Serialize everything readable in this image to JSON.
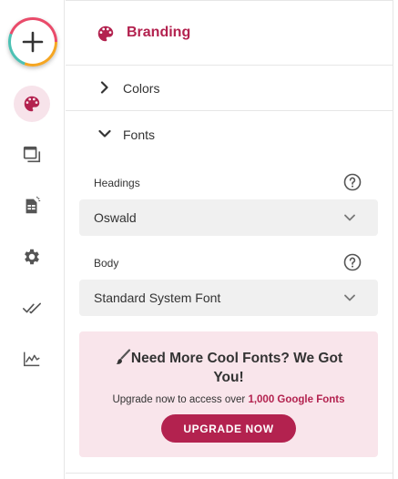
{
  "rail": {
    "add_button": "plus-icon",
    "items": [
      {
        "icon": "palette-icon",
        "active": true
      },
      {
        "icon": "window-stack-icon",
        "active": false
      },
      {
        "icon": "sheet-icon",
        "active": false
      },
      {
        "icon": "gear-icon",
        "active": false
      },
      {
        "icon": "double-check-icon",
        "active": false
      },
      {
        "icon": "chart-icon",
        "active": false
      }
    ]
  },
  "header": {
    "title": "Branding",
    "icon": "palette-icon"
  },
  "sections": {
    "colors_label": "Colors",
    "fonts_label": "Fonts"
  },
  "fonts": {
    "headings_label": "Headings",
    "headings_value": "Oswald",
    "body_label": "Body",
    "body_value": "Standard System Font"
  },
  "promo": {
    "headline_line1": "Need More Cool Fonts? We Got",
    "headline_line2": "You!",
    "sub_text": "Upgrade now to access over ",
    "sub_highlight": "1,000 Google Fonts",
    "button_label": "UPGRADE NOW"
  },
  "colors": {
    "accent": "#b3224f",
    "active_bg": "#f7e3ea",
    "promo_bg": "#f9e5eb",
    "select_bg": "#f0f0f0"
  }
}
